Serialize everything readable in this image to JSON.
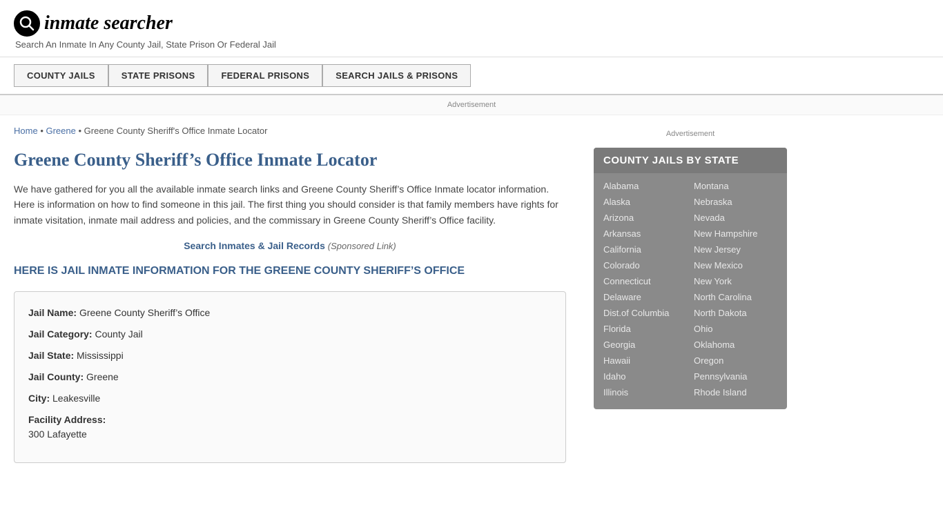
{
  "header": {
    "logo_icon": "🔍",
    "logo_text": "inmate searcher",
    "tagline": "Search An Inmate In Any County Jail, State Prison Or Federal Jail"
  },
  "nav": {
    "buttons": [
      {
        "label": "COUNTY JAILS",
        "id": "county-jails"
      },
      {
        "label": "STATE PRISONS",
        "id": "state-prisons"
      },
      {
        "label": "FEDERAL PRISONS",
        "id": "federal-prisons"
      },
      {
        "label": "SEARCH JAILS & PRISONS",
        "id": "search-jails"
      }
    ]
  },
  "ad_banner": "Advertisement",
  "breadcrumb": {
    "home": "Home",
    "parent": "Greene",
    "current": "Greene County Sheriff's Office Inmate Locator"
  },
  "page_title": "Greene County Sheriff’s Office Inmate Locator",
  "body_text": "We have gathered for you all the available inmate search links and Greene County Sheriff’s Office Inmate locator information. Here is information on how to find someone in this jail. The first thing you should consider is that family members have rights for inmate visitation, inmate mail address and policies, and the commissary in Greene County Sheriff’s Office facility.",
  "sponsored": {
    "link_text": "Search Inmates & Jail Records",
    "link_suffix": "(Sponsored Link)"
  },
  "section_heading": "HERE IS JAIL INMATE INFORMATION FOR THE GREENE COUNTY SHERIFF’S OFFICE",
  "info_box": {
    "jail_name_label": "Jail Name:",
    "jail_name_value": "Greene County Sheriff’s Office",
    "jail_category_label": "Jail Category:",
    "jail_category_value": "County Jail",
    "jail_state_label": "Jail State:",
    "jail_state_value": "Mississippi",
    "jail_county_label": "Jail County:",
    "jail_county_value": "Greene",
    "city_label": "City:",
    "city_value": "Leakesville",
    "facility_address_label": "Facility Address:",
    "facility_address_value": "300 Lafayette"
  },
  "sidebar": {
    "ad_text": "Advertisement",
    "title": "COUNTY JAILS BY STATE",
    "states_col1": [
      "Alabama",
      "Alaska",
      "Arizona",
      "Arkansas",
      "California",
      "Colorado",
      "Connecticut",
      "Delaware",
      "Dist.of Columbia",
      "Florida",
      "Georgia",
      "Hawaii",
      "Idaho",
      "Illinois"
    ],
    "states_col2": [
      "Montana",
      "Nebraska",
      "Nevada",
      "New Hampshire",
      "New Jersey",
      "New Mexico",
      "New York",
      "North Carolina",
      "North Dakota",
      "Ohio",
      "Oklahoma",
      "Oregon",
      "Pennsylvania",
      "Rhode Island"
    ]
  }
}
